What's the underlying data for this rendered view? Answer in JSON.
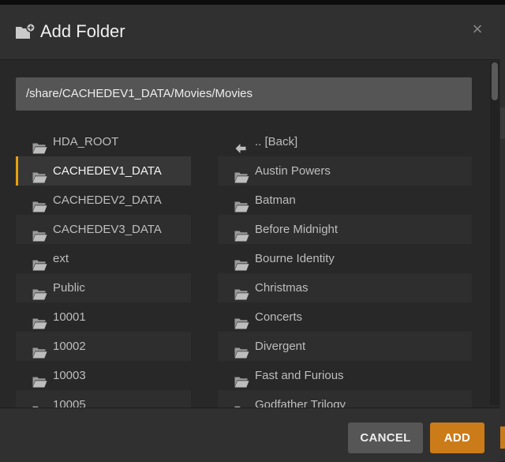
{
  "dialog": {
    "title": "Add Folder",
    "close_symbol": "×"
  },
  "path": {
    "value": "/share/CACHEDEV1_DATA/Movies/Movies"
  },
  "roots": [
    {
      "label": "HDA_ROOT",
      "selected": false
    },
    {
      "label": "CACHEDEV1_DATA",
      "selected": true
    },
    {
      "label": "CACHEDEV2_DATA",
      "selected": false
    },
    {
      "label": "CACHEDEV3_DATA",
      "selected": false
    },
    {
      "label": "ext",
      "selected": false
    },
    {
      "label": "Public",
      "selected": false
    },
    {
      "label": "10001",
      "selected": false
    },
    {
      "label": "10002",
      "selected": false
    },
    {
      "label": "10003",
      "selected": false
    },
    {
      "label": "10005",
      "selected": false
    }
  ],
  "folders": {
    "back_label": ".. [Back]",
    "items": [
      "Austin Powers",
      "Batman",
      "Before Midnight",
      "Bourne Identity",
      "Christmas",
      "Concerts",
      "Divergent",
      "Fast and Furious",
      "Godfather Trilogy"
    ]
  },
  "buttons": {
    "cancel": "CANCEL",
    "add": "ADD"
  },
  "icons": {
    "title": "folder-add-icon",
    "close": "close-icon",
    "folder": "folder-open-icon",
    "back": "arrow-left-icon"
  },
  "colors": {
    "accent": "#e5a00d",
    "add_button": "#cc7b19",
    "dialog_bg": "#282828",
    "header_bg": "#303030",
    "path_bg": "#555555"
  }
}
